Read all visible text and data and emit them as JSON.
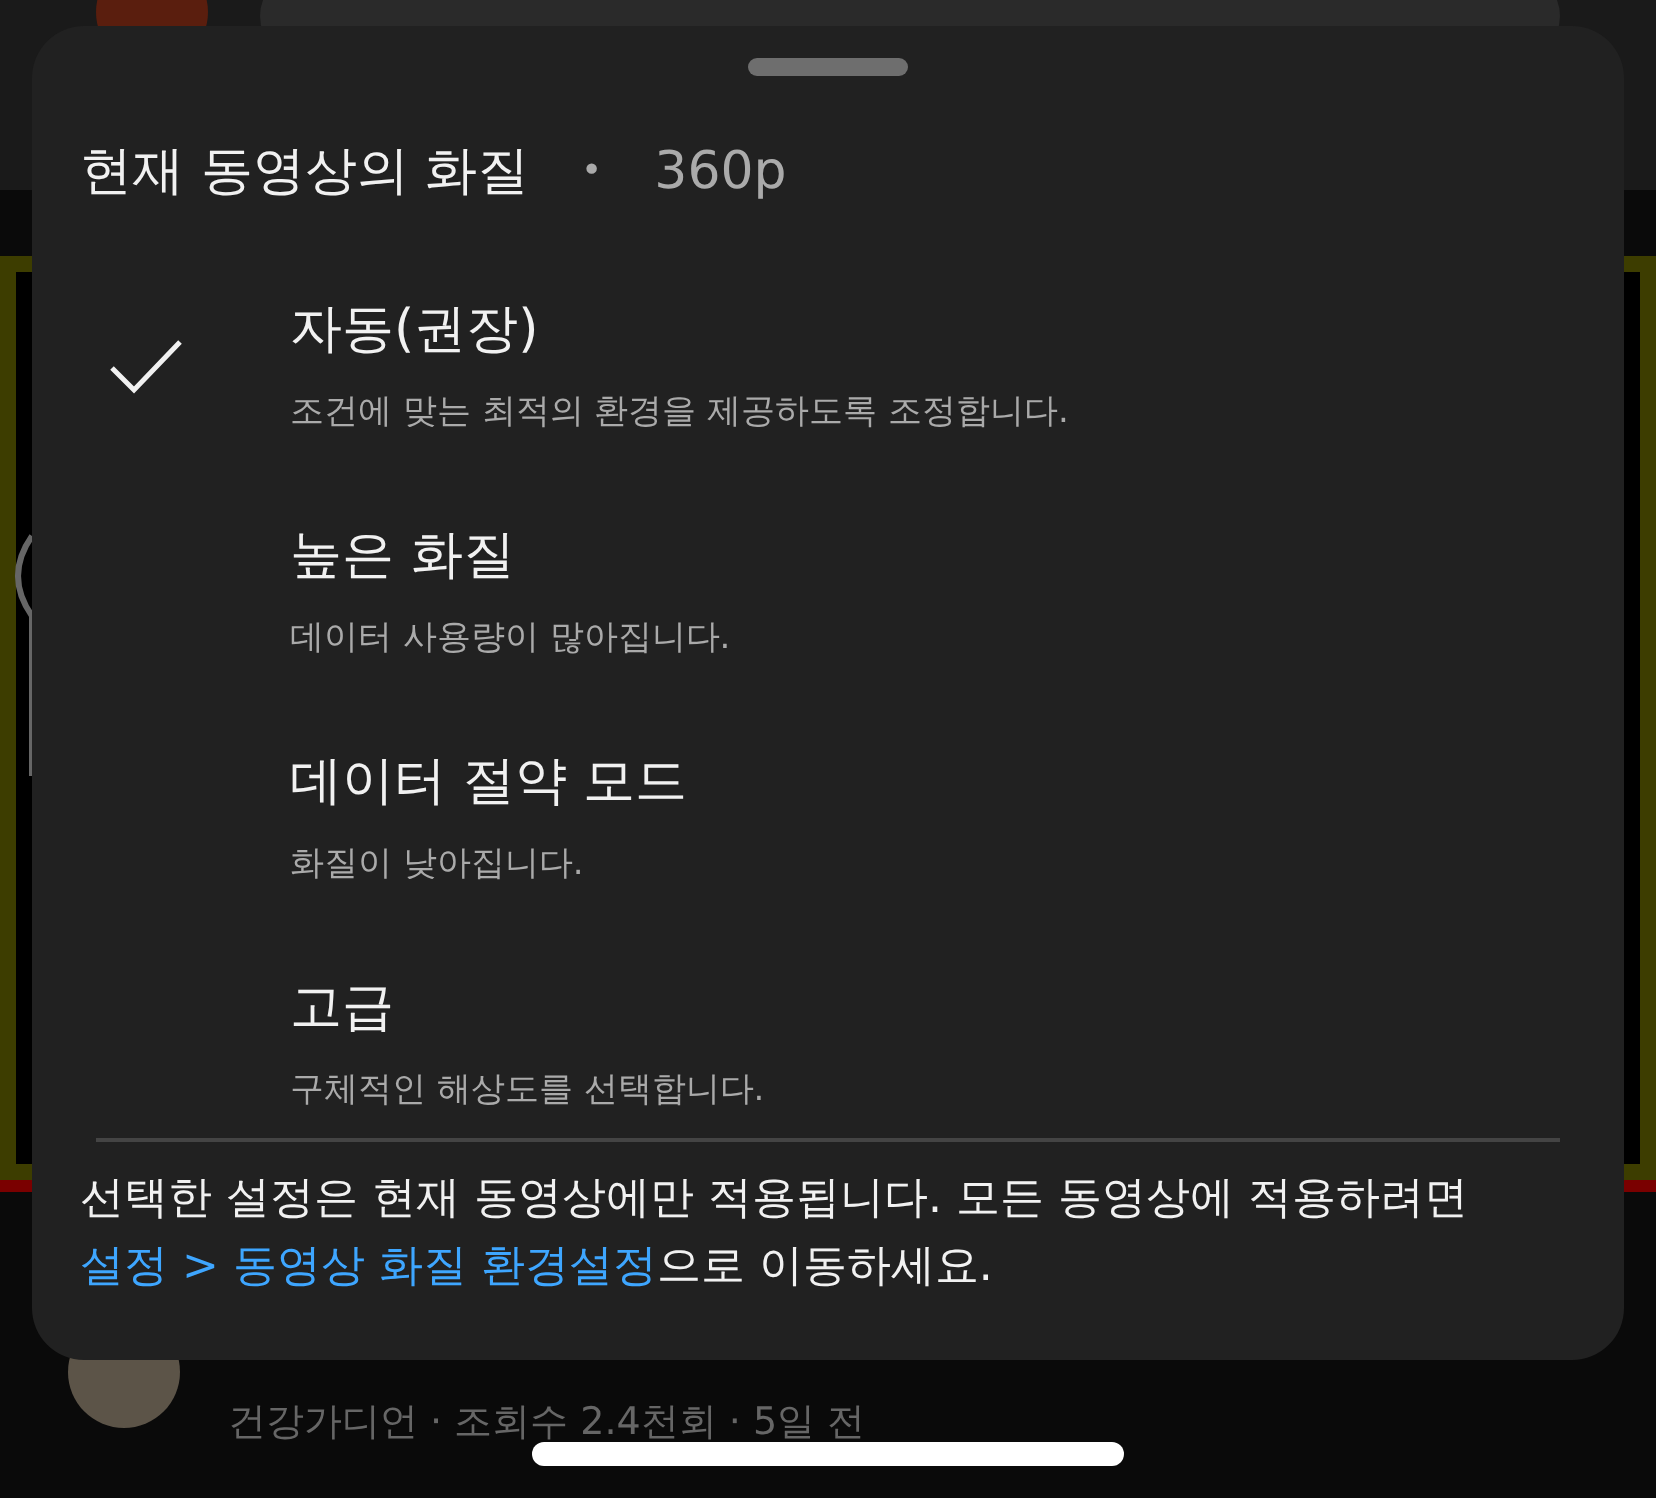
{
  "background": {
    "video_meta": "건강가디언 · 조회수 2.4천회 · 5일 전",
    "progress": {
      "level": 1
    }
  },
  "sheet": {
    "title": "현재 동영상의 화질",
    "separator": "•",
    "current": "360p",
    "options": [
      {
        "title": "자동(권장)",
        "description": "조건에 맞는 최적의 환경을 제공하도록 조정합니다.",
        "selected": true
      },
      {
        "title": "높은 화질",
        "description": "데이터 사용량이 많아집니다.",
        "selected": false
      },
      {
        "title": "데이터 절약 모드",
        "description": "화질이 낮아집니다.",
        "selected": false
      },
      {
        "title": "고급",
        "description": "구체적인 해상도를 선택합니다.",
        "selected": false
      }
    ],
    "footer": {
      "before": "선택한 설정은 현재 동영상에만 적용됩니다. 모든 동영상에 적용하려면 ",
      "link": "설정 > 동영상 화질 환경설정",
      "after": "으로 이동하세요."
    }
  }
}
